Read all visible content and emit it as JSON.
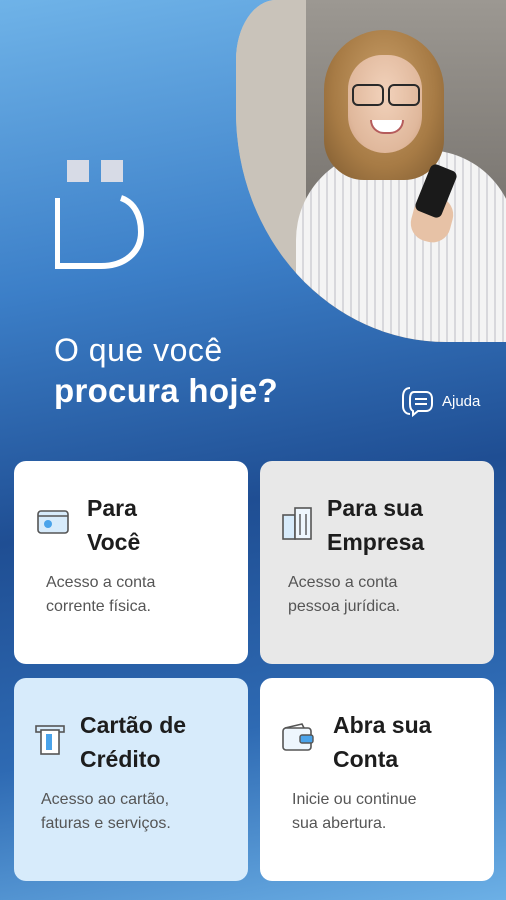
{
  "headline": {
    "line1": "O que você",
    "line2": "procura hoje?"
  },
  "help": {
    "label": "Ajuda",
    "icon": "chat-help-icon"
  },
  "cards": [
    {
      "title_line1": "Para",
      "title_line2": "Você",
      "desc_line1": "Acesso a conta",
      "desc_line2": "corrente física.",
      "icon": "account-card-icon"
    },
    {
      "title_line1": "Para sua",
      "title_line2": "Empresa",
      "desc_line1": "Acesso a conta",
      "desc_line2": "pessoa jurídica.",
      "icon": "building-icon"
    },
    {
      "title_line1": "Cartão de",
      "title_line2": "Crédito",
      "desc_line1": "Acesso ao cartão,",
      "desc_line2": "faturas e serviços.",
      "icon": "credit-card-icon"
    },
    {
      "title_line1": "Abra sua",
      "title_line2": "Conta",
      "desc_line1": "Inicie ou continue",
      "desc_line2": "sua abertura.",
      "icon": "wallet-icon"
    }
  ],
  "colors": {
    "card_white": "#ffffff",
    "card_gray": "#e8e8e8",
    "card_blue": "#d7ebfb",
    "brand_blue": "#1f4e93"
  }
}
